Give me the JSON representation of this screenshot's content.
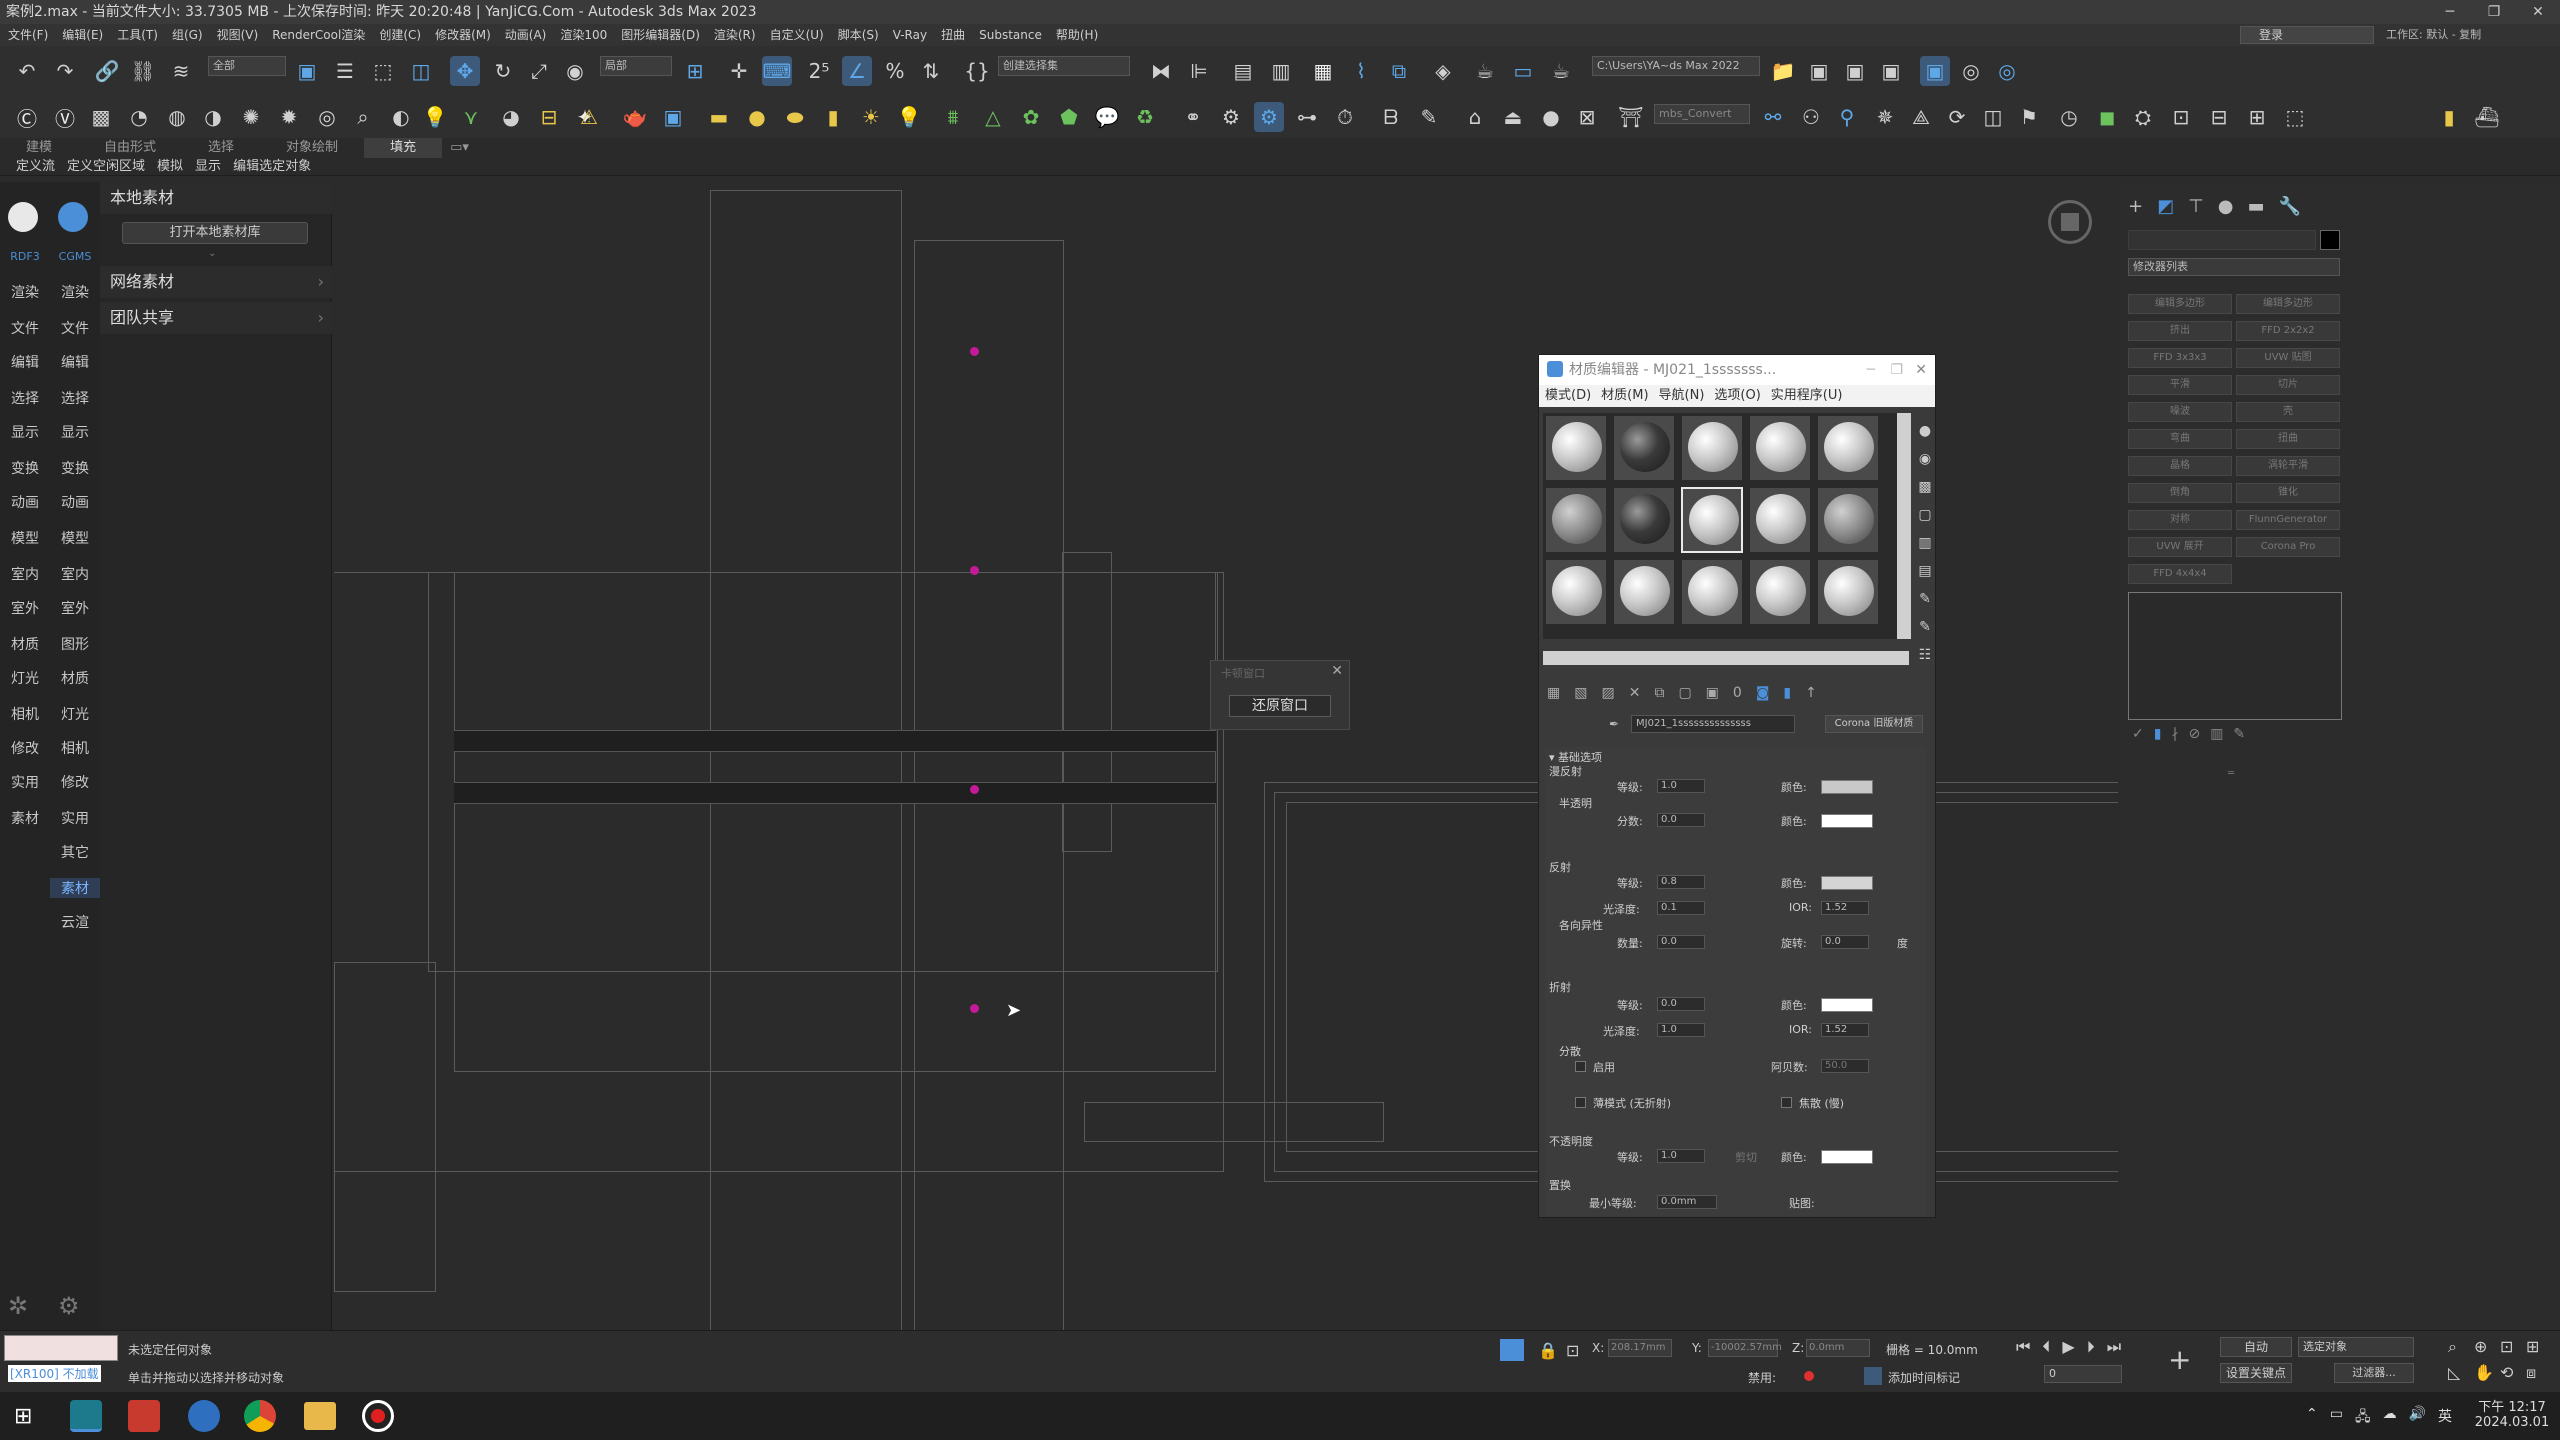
{
  "titlebar": {
    "title": "案例2.max - 当前文件大小: 33.7305 MB - 上次保存时间: 昨天 20:20:48 | YanJiCG.Com - Autodesk 3ds Max 2023"
  },
  "menubar": {
    "items": [
      "文件(F)",
      "编辑(E)",
      "工具(T)",
      "组(G)",
      "视图(V)",
      "RenderCool渲染",
      "创建(C)",
      "修改器(M)",
      "动画(A)",
      "渲染100",
      "图形编辑器(D)",
      "渲染(R)",
      "自定义(U)",
      "脚本(S)",
      "V-Ray",
      "扭曲",
      "Substance",
      "帮助(H)"
    ],
    "login": "登录",
    "workspace_label": "工作区:",
    "workspace_value": "默认 - 复制"
  },
  "toolbar": {
    "selection_filter": "全部",
    "ref_coord": "局部",
    "named_selection": "创建选择集",
    "path_field": "C:\\Users\\YA~ds Max 2022",
    "anim_field": "mbs_Convert"
  },
  "ribbon": {
    "tabs": [
      "建模",
      "自由形式",
      "选择",
      "对象绘制",
      "填充"
    ],
    "active": "填充"
  },
  "ribbon2": {
    "items": [
      "定义流",
      "定义空闲区域",
      "模拟",
      "显示",
      "编辑选定对象"
    ]
  },
  "leftbar": {
    "top_labels": [
      "RDF3",
      "CGMS"
    ],
    "col1": [
      "渲染",
      "文件",
      "编辑",
      "选择",
      "显示",
      "变换",
      "动画",
      "模型",
      "室内",
      "室外",
      "材质",
      "灯光",
      "相机",
      "修改",
      "实用",
      "素材"
    ],
    "col2": [
      "渲染",
      "文件",
      "编辑",
      "选择",
      "显示",
      "变换",
      "动画",
      "模型",
      "室内",
      "室外",
      "图形",
      "材质",
      "灯光",
      "相机",
      "修改",
      "实用",
      "其它",
      "素材",
      "云渲"
    ]
  },
  "library": {
    "local_title": "本地素材",
    "open_button": "打开本地素材库",
    "network_title": "网络素材",
    "team_title": "团队共享"
  },
  "restore_dialog": {
    "title": "卡顿窗口",
    "button": "还原窗口"
  },
  "material_editor": {
    "title": "材质编辑器 - MJ021_1sssssss...",
    "menu": [
      "模式(D)",
      "材质(M)",
      "导航(N)",
      "选项(O)",
      "实用程序(U)"
    ],
    "material_name": "MJ021_1ssssssssssssss",
    "material_type": "Corona 旧版材质",
    "section": "基础选项",
    "diffuse": {
      "label": "漫反射",
      "level_label": "等级:",
      "level": "1.0",
      "color_label": "颜色:"
    },
    "translucency": {
      "label": "半透明",
      "fraction_label": "分数:",
      "fraction": "0.0",
      "color_label": "颜色:"
    },
    "reflection": {
      "label": "反射",
      "level_label": "等级:",
      "level": "0.8",
      "gloss_label": "光泽度:",
      "gloss": "0.1",
      "ior_label": "IOR:",
      "ior": "1.52",
      "color_label": "颜色:"
    },
    "anisotropy": {
      "label": "各向异性",
      "amount_label": "数量:",
      "amount": "0.0",
      "rotation_label": "旋转:",
      "rotation": "0.0",
      "unit": "度"
    },
    "refraction": {
      "label": "折射",
      "level_label": "等级:",
      "level": "0.0",
      "gloss_label": "光泽度:",
      "gloss": "1.0",
      "ior_label": "IOR:",
      "ior": "1.52",
      "color_label": "颜色:"
    },
    "dispersion": {
      "label": "分散",
      "enable": "启用",
      "abbe_label": "阿贝数:",
      "abbe": "50.0"
    },
    "thin_mode": "薄模式 (无折射)",
    "caustics": "焦散 (慢)",
    "opacity": {
      "label": "不透明度",
      "level_label": "等级:",
      "level": "1.0",
      "color_label": "颜色:",
      "clip": "剪切"
    },
    "displacement": {
      "label": "置换",
      "min_label": "最小等级:",
      "min": "0.0mm",
      "max_label": "贴图:"
    }
  },
  "command_panel": {
    "modifier_list": "修改器列表",
    "buttons": [
      "编辑多边形",
      "编辑多边形",
      "挤出",
      "FFD 2x2x2",
      "FFD 3x3x3",
      "UVW 贴图",
      "平滑",
      "切片",
      "噪波",
      "壳",
      "弯曲",
      "扭曲",
      "晶格",
      "涡轮平滑",
      "倒角",
      "锥化",
      "对称",
      "FlunnGenerator",
      "UVW 展开",
      "Corona Pro",
      "FFD 4x4x4"
    ]
  },
  "status": {
    "script_tag": "[XR100] 不加载",
    "line1": "未选定任何对象",
    "line2": "单击并拖动以选择并移动对象",
    "x_label": "X:",
    "x": "208.17mm",
    "y_label": "Y:",
    "y": "-10002.57mm",
    "z_label": "Z:",
    "z": "0.0mm",
    "grid": "栅格 = 10.0mm",
    "add_tag": "添加时间标记",
    "disabled": "禁用:",
    "auto": "自动",
    "set_key": "设置关键点",
    "selected": "选定对象",
    "filter": "过滤器...",
    "frame": "0"
  },
  "taskbar": {
    "time": "下午 12:17",
    "date": "2024.03.01",
    "ime": "英"
  },
  "colors": {
    "accent": "#4a8fd8",
    "dot": "#c41a9a"
  }
}
